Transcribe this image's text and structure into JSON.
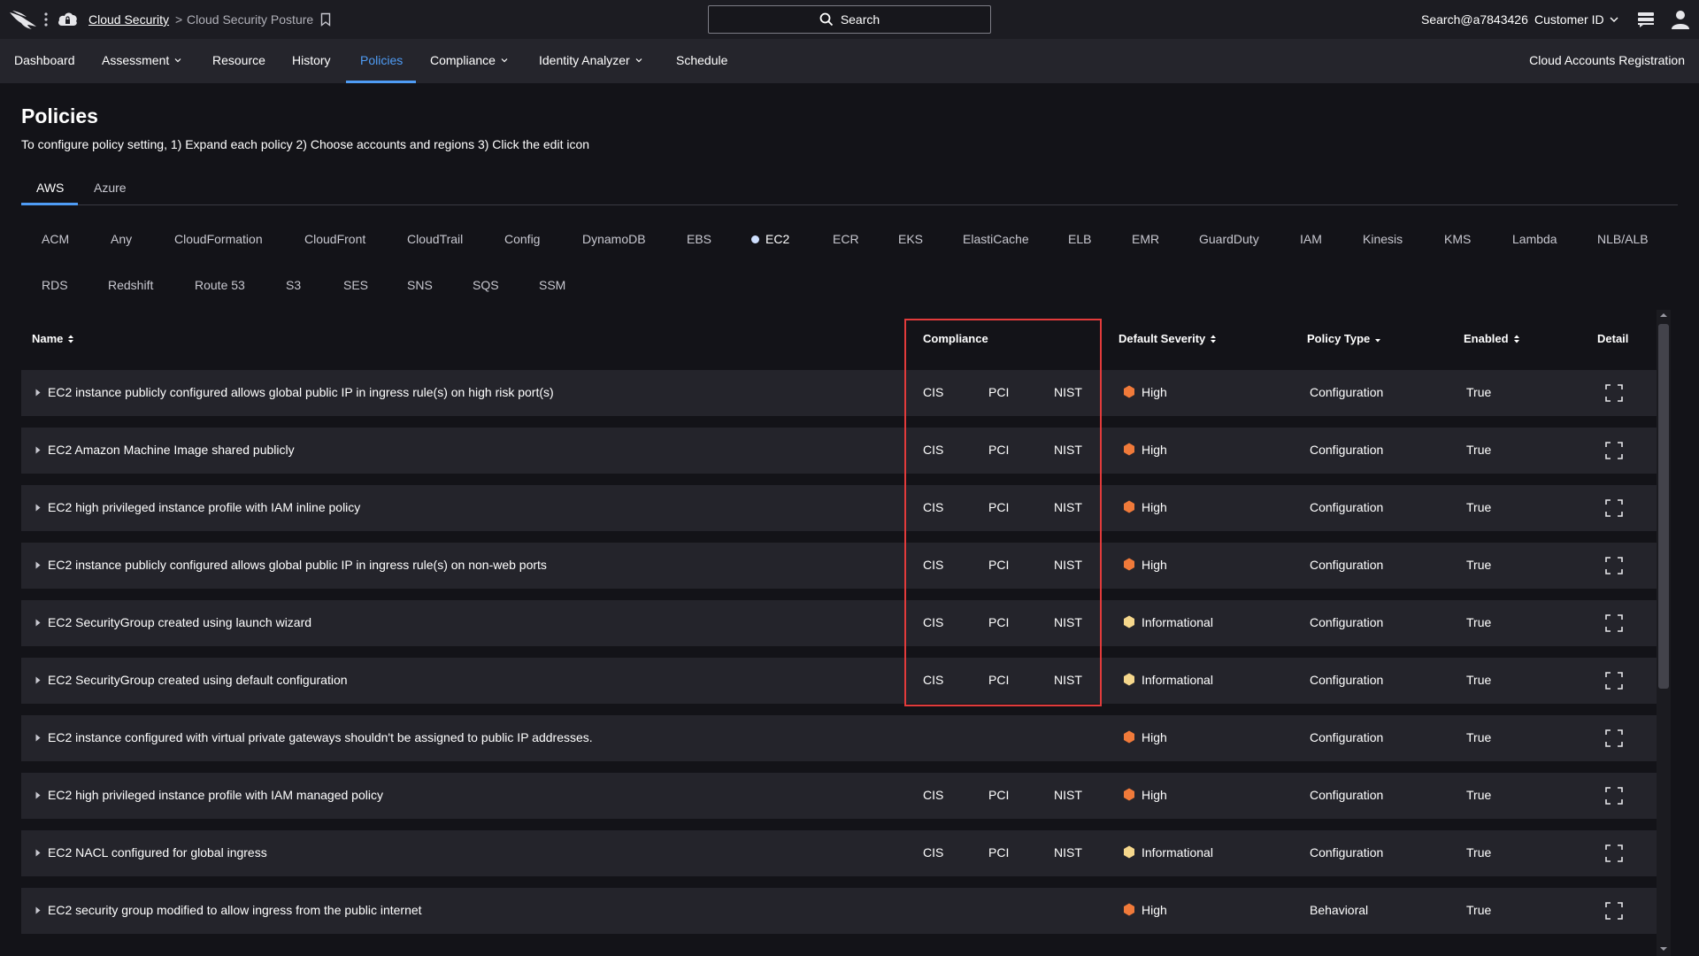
{
  "header": {
    "breadcrumb_root": "Cloud Security",
    "breadcrumb_sep": ">",
    "breadcrumb_current": "Cloud Security Posture",
    "search_label": "Search",
    "user": "Search@a7843426",
    "customer": "Customer ID"
  },
  "nav": {
    "items": [
      "Dashboard",
      "Assessment",
      "Resource",
      "History",
      "Policies",
      "Compliance",
      "Identity Analyzer",
      "Schedule"
    ],
    "active": "Policies",
    "right": "Cloud Accounts Registration"
  },
  "page": {
    "title": "Policies",
    "subtitle": "To configure policy setting, 1) Expand each policy 2) Choose accounts and regions 3) Click the edit icon"
  },
  "cloud_tabs": [
    "AWS",
    "Azure"
  ],
  "cloud_tab_active": "AWS",
  "services": {
    "row1": [
      "ACM",
      "Any",
      "CloudFormation",
      "CloudFront",
      "CloudTrail",
      "Config",
      "DynamoDB",
      "EBS",
      "EC2",
      "ECR",
      "EKS",
      "ElastiCache",
      "ELB",
      "EMR",
      "GuardDuty",
      "IAM",
      "Kinesis",
      "KMS",
      "Lambda",
      "NLB/ALB"
    ],
    "row2": [
      "RDS",
      "Redshift",
      "Route 53",
      "S3",
      "SES",
      "SNS",
      "SQS",
      "SSM"
    ],
    "active": "EC2"
  },
  "table": {
    "columns": {
      "name": "Name",
      "compliance": "Compliance",
      "severity": "Default Severity",
      "type": "Policy Type",
      "enabled": "Enabled",
      "detail": "Detail"
    },
    "rows": [
      {
        "name": "EC2 instance publicly configured allows global public IP in ingress rule(s) on high risk port(s)",
        "cis": "CIS",
        "pci": "PCI",
        "nist": "NIST",
        "severity": "High",
        "type": "Configuration",
        "enabled": "True"
      },
      {
        "name": "EC2 Amazon Machine Image shared publicly",
        "cis": "CIS",
        "pci": "PCI",
        "nist": "NIST",
        "severity": "High",
        "type": "Configuration",
        "enabled": "True"
      },
      {
        "name": "EC2 high privileged instance profile with IAM inline policy",
        "cis": "CIS",
        "pci": "PCI",
        "nist": "NIST",
        "severity": "High",
        "type": "Configuration",
        "enabled": "True"
      },
      {
        "name": "EC2 instance publicly configured allows global public IP in ingress rule(s) on non-web ports",
        "cis": "CIS",
        "pci": "PCI",
        "nist": "NIST",
        "severity": "High",
        "type": "Configuration",
        "enabled": "True"
      },
      {
        "name": "EC2 SecurityGroup created using launch wizard",
        "cis": "CIS",
        "pci": "PCI",
        "nist": "NIST",
        "severity": "Informational",
        "type": "Configuration",
        "enabled": "True"
      },
      {
        "name": "EC2 SecurityGroup created using default configuration",
        "cis": "CIS",
        "pci": "PCI",
        "nist": "NIST",
        "severity": "Informational",
        "type": "Configuration",
        "enabled": "True"
      },
      {
        "name": "EC2 instance configured with virtual private gateways shouldn't be assigned to public IP addresses.",
        "cis": "",
        "pci": "",
        "nist": "",
        "severity": "High",
        "type": "Configuration",
        "enabled": "True"
      },
      {
        "name": "EC2 high privileged instance profile with IAM managed policy",
        "cis": "CIS",
        "pci": "PCI",
        "nist": "NIST",
        "severity": "High",
        "type": "Configuration",
        "enabled": "True"
      },
      {
        "name": "EC2 NACL configured for global ingress",
        "cis": "CIS",
        "pci": "PCI",
        "nist": "NIST",
        "severity": "Informational",
        "type": "Configuration",
        "enabled": "True"
      },
      {
        "name": "EC2 security group modified to allow ingress from the public internet",
        "cis": "",
        "pci": "",
        "nist": "",
        "severity": "High",
        "type": "Behavioral",
        "enabled": "True"
      }
    ]
  },
  "colors": {
    "accent": "#4f9cf5",
    "high": "#f07a3a",
    "informational": "#f5d78c",
    "highlight_box": "#e23b3b"
  }
}
